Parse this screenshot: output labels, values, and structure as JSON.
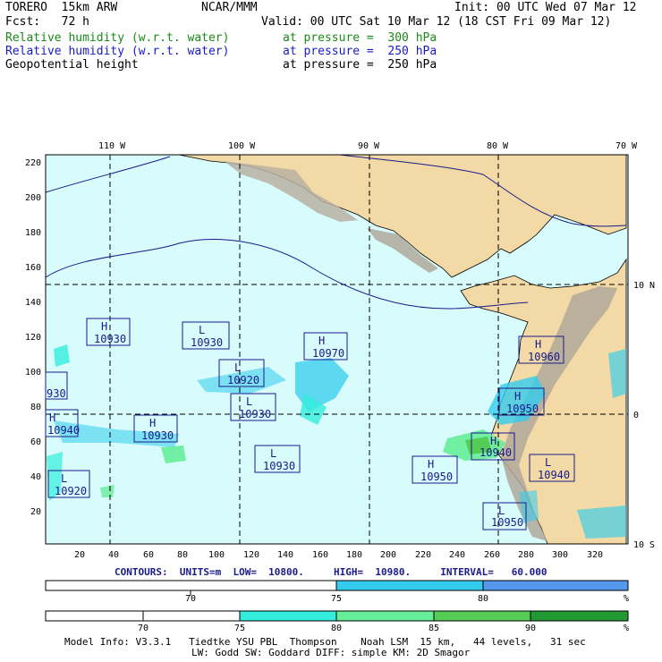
{
  "header": {
    "model": "TORERO  15km ARW",
    "center": "NCAR/MMM",
    "init": "Init: 00 UTC Wed 07 Mar 12",
    "fcst": "Fcst:   72 h",
    "valid": "Valid: 00 UTC Sat 10 Mar 12 (18 CST Fri 09 Mar 12)",
    "fields": [
      {
        "name": "Relative humidity (w.r.t. water)",
        "level": "at pressure =  300 hPa",
        "color": "#1a8a1a"
      },
      {
        "name": "Relative humidity (w.r.t. water)",
        "level": "at pressure =  250 hPa",
        "color": "#1a1ac8"
      },
      {
        "name": "Geopotential height",
        "level": "at pressure =  250 hPa",
        "color": "#000000"
      }
    ]
  },
  "map": {
    "top_lon_labels": [
      "110 W",
      "100 W",
      "90 W",
      "80 W",
      "70 W"
    ],
    "right_lat_labels": [
      "10 N",
      "0",
      "10 S"
    ],
    "y_ticks": [
      "220",
      "200",
      "180",
      "160",
      "140",
      "120",
      "100",
      "80",
      "60",
      "40",
      "20"
    ],
    "x_ticks": [
      "20",
      "40",
      "60",
      "80",
      "100",
      "120",
      "140",
      "160",
      "180",
      "200",
      "220",
      "240",
      "260",
      "280",
      "300",
      "320"
    ],
    "pressure_centers": [
      {
        "type": "H",
        "value": "10930"
      },
      {
        "type": "L",
        "value": "10930"
      },
      {
        "type": "H",
        "value": "10970"
      },
      {
        "type": "L",
        "value": "10920"
      },
      {
        "type": "",
        "value": "930"
      },
      {
        "type": "L",
        "value": "10930"
      },
      {
        "type": "H",
        "value": "10940"
      },
      {
        "type": "H",
        "value": "10930"
      },
      {
        "type": "L",
        "value": "10930"
      },
      {
        "type": "L",
        "value": "10920"
      },
      {
        "type": "H",
        "value": "10960"
      },
      {
        "type": "H",
        "value": "10950"
      },
      {
        "type": "H",
        "value": "10940"
      },
      {
        "type": "H",
        "value": "10950"
      },
      {
        "type": "L",
        "value": "10940"
      },
      {
        "type": "L",
        "value": "10950"
      }
    ],
    "colors": {
      "ocean": "#d8fbfb",
      "land": "#f2d9a6",
      "terrain": "#b0a89a",
      "contour": "#1a1a8c"
    }
  },
  "contours_line": "CONTOURS:  UNITS=m  LOW=  10800.     HIGH=  10980.     INTERVAL=   60.000",
  "colorbar_250": {
    "labels": [
      "70",
      "75",
      "80",
      "%"
    ],
    "colors": [
      "#ffffff",
      "#33ccee",
      "#5599ee"
    ]
  },
  "colorbar_300": {
    "labels": [
      "70",
      "75",
      "80",
      "85",
      "90",
      "%"
    ],
    "colors": [
      "#ffffff",
      "#ffffff",
      "#33eedd",
      "#66ee99",
      "#55cc55",
      "#229933"
    ]
  },
  "footer": {
    "line1": "Model Info: V3.3.1   Tiedtke YSU PBL  Thompson    Noah LSM  15 km,   44 levels,   31 sec",
    "line2": "LW: Godd SW: Goddard DIFF: simple KM: 2D Smagor"
  }
}
